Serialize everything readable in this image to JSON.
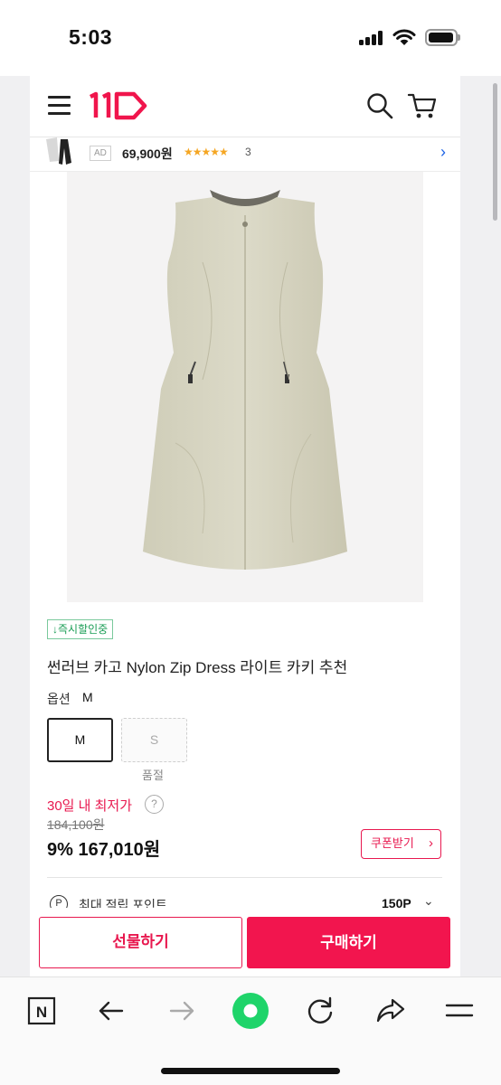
{
  "status_bar": {
    "time": "5:03"
  },
  "header": {
    "logo_text": "11",
    "brand_color": "#f0154c",
    "icons": [
      "menu-icon",
      "search-icon",
      "cart-icon"
    ]
  },
  "ad_strip": {
    "badge": "AD",
    "price": "69,900원",
    "stars": "★★★★★",
    "review_count": "3"
  },
  "product": {
    "cert_badge": "↓즉시할인중",
    "title": "썬러브 카고 Nylon Zip Dress 라이트 카키 추천",
    "option_label": "옵션",
    "option_selected": "M",
    "options": [
      {
        "label": "M",
        "state": "selected"
      },
      {
        "label": "S",
        "state": "soldout",
        "note": "품절"
      }
    ],
    "lowest_price_label": "30일 내 최저가",
    "help_glyph": "?",
    "original_price": "184,100원",
    "sale_price": "9% 167,010원",
    "coupon_button": "쿠폰받기",
    "points_icon": "P",
    "points_label": "최대 적립 포인트",
    "points_value": "150P"
  },
  "actions": {
    "gift": "선물하기",
    "buy": "구매하기"
  },
  "browser_toolbar": {
    "n_label": "N",
    "icons": [
      "naver-n-icon",
      "back-arrow-icon",
      "forward-arrow-icon",
      "green-dot-icon",
      "reload-icon",
      "share-icon",
      "menu-lines-icon"
    ]
  }
}
